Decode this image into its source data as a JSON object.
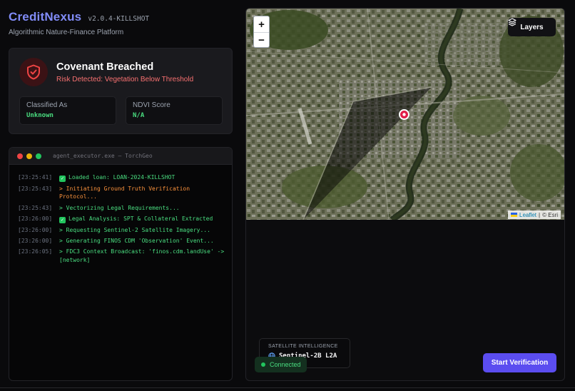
{
  "header": {
    "brand": "CreditNexus",
    "version": "v2.0.4-KILLSHOT",
    "subtitle": "Algorithmic Nature-Finance Platform"
  },
  "status": {
    "icon": "shield-alert-icon",
    "title": "Covenant Breached",
    "subtitle": "Risk Detected: Vegetation Below Threshold",
    "metrics": [
      {
        "label": "Classified As",
        "value": "Unknown"
      },
      {
        "label": "NDVI Score",
        "value": "N/A"
      }
    ]
  },
  "terminal": {
    "title": "agent_executor.exe — TorchGeo",
    "logs": [
      {
        "time": "[23:25:41]",
        "text": "Loaded loan: LOAN-2024-KILLSHOT",
        "kind": "check"
      },
      {
        "time": "[23:25:43]",
        "text": "> Initiating Ground Truth Verification Protocol...",
        "kind": "warn"
      },
      {
        "time": "[23:25:43]",
        "text": "> Vectorizing Legal Requirements...",
        "kind": "ok"
      },
      {
        "time": "[23:26:00]",
        "text": "Legal Analysis: SPT & Collateral Extracted",
        "kind": "check"
      },
      {
        "time": "[23:26:00]",
        "text": "> Requesting Sentinel-2 Satellite Imagery...",
        "kind": "ok"
      },
      {
        "time": "[23:26:00]",
        "text": "> Generating FINOS CDM 'Observation' Event...",
        "kind": "ok"
      },
      {
        "time": "[23:26:05]",
        "text": "> FDC3 Context Broadcast: 'finos.cdm.landUse' -> [network]",
        "kind": "ok"
      }
    ]
  },
  "map": {
    "zoom_in": "+",
    "zoom_out": "−",
    "layers_label": "Layers",
    "attribution_link": "Leaflet",
    "attribution_sep": "|",
    "attribution_text": "© Esri"
  },
  "satellite": {
    "label": "SATELLITE INTELLIGENCE",
    "value": "Sentinel-2B L2A"
  },
  "connection": {
    "label": "Connected"
  },
  "actions": {
    "start_label": "Start Verification"
  },
  "colors": {
    "brand": "#818cf8",
    "danger": "#ef4444",
    "success": "#4ade80",
    "warn": "#fb923c",
    "primary_button": "#5b4df0"
  }
}
